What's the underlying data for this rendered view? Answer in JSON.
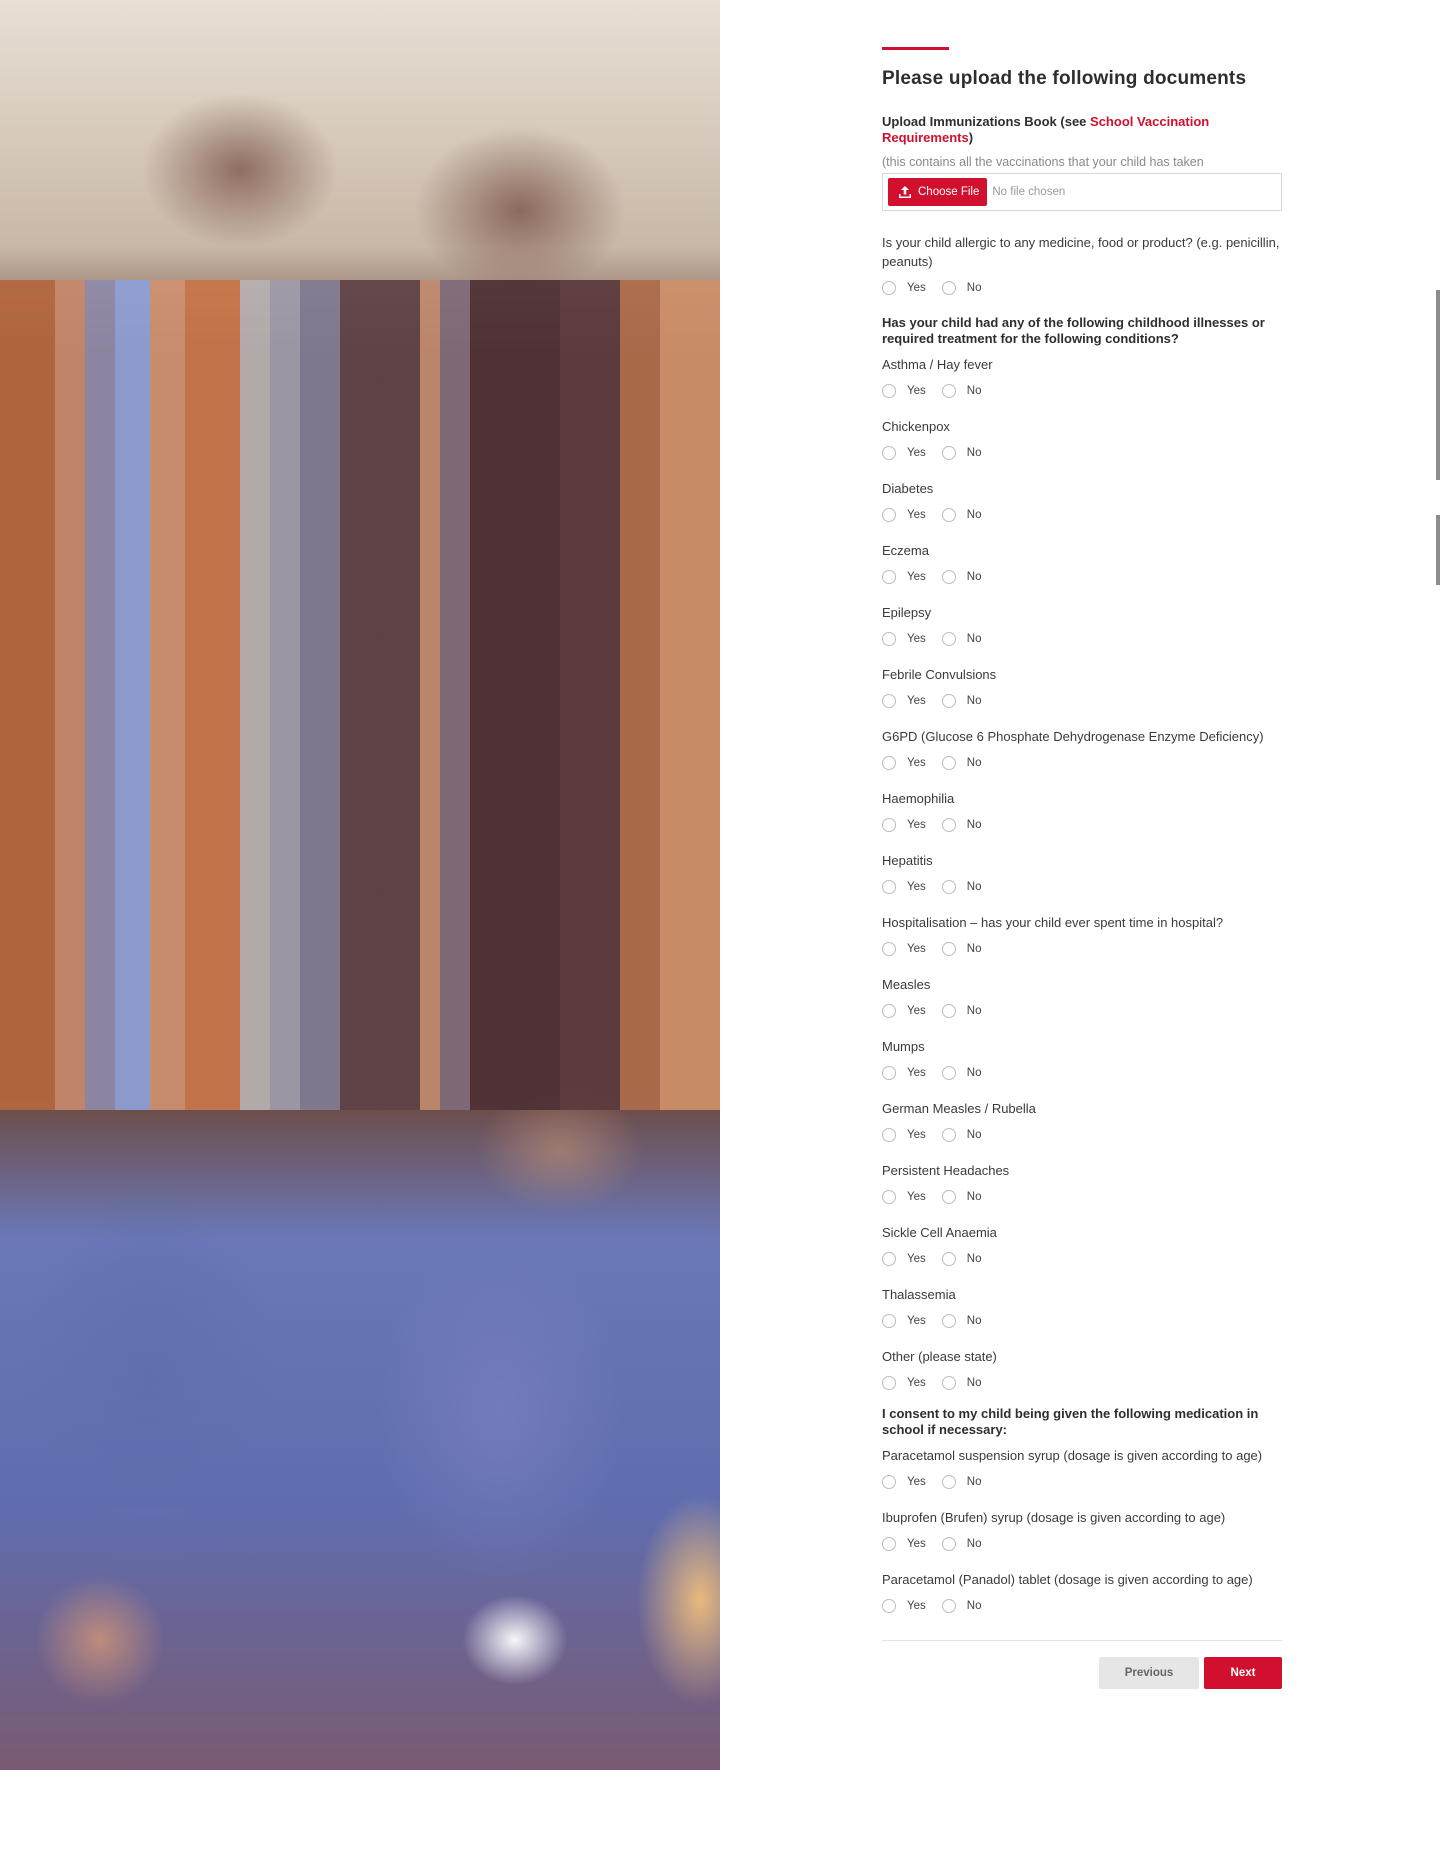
{
  "form": {
    "title": "Please upload the following documents",
    "upload": {
      "label_prefix": "Upload Immunizations Book (see ",
      "link_text": "School Vaccination Requirements",
      "label_suffix": ")",
      "help": "(this contains all the vaccinations that your child has taken",
      "button_label": "Choose File",
      "button_icon": "upload-icon",
      "status": "No file chosen"
    },
    "allergy_question": "Is your child allergic to any medicine, food or product? (e.g. penicillin, peanuts)",
    "illness_heading": "Has your child had any of the following childhood illnesses or required treatment for the following conditions?",
    "conditions": [
      "Asthma / Hay fever",
      "Chickenpox",
      "Diabetes",
      "Eczema",
      "Epilepsy",
      "Febrile Convulsions",
      "G6PD (Glucose 6 Phosphate Dehydrogenase Enzyme Deficiency)",
      "Haemophilia",
      "Hepatitis",
      "Hospitalisation – has your child ever spent time in hospital?",
      "Measles",
      "Mumps",
      "German Measles / Rubella",
      "Persistent Headaches",
      "Sickle Cell Anaemia",
      "Thalassemia",
      "Other (please state)"
    ],
    "consent_heading": "I consent to my child being given the following medication in school if necessary:",
    "medications": [
      "Paracetamol suspension syrup (dosage is given according to age)",
      "Ibuprofen (Brufen) syrup (dosage is given according to age)",
      "Paracetamol (Panadol) tablet (dosage is given according to age)"
    ],
    "yes_label": "Yes",
    "no_label": "No",
    "previous_label": "Previous",
    "next_label": "Next"
  },
  "colors": {
    "accent": "#d0102e",
    "text": "#333333",
    "muted": "#8a8a8a"
  }
}
